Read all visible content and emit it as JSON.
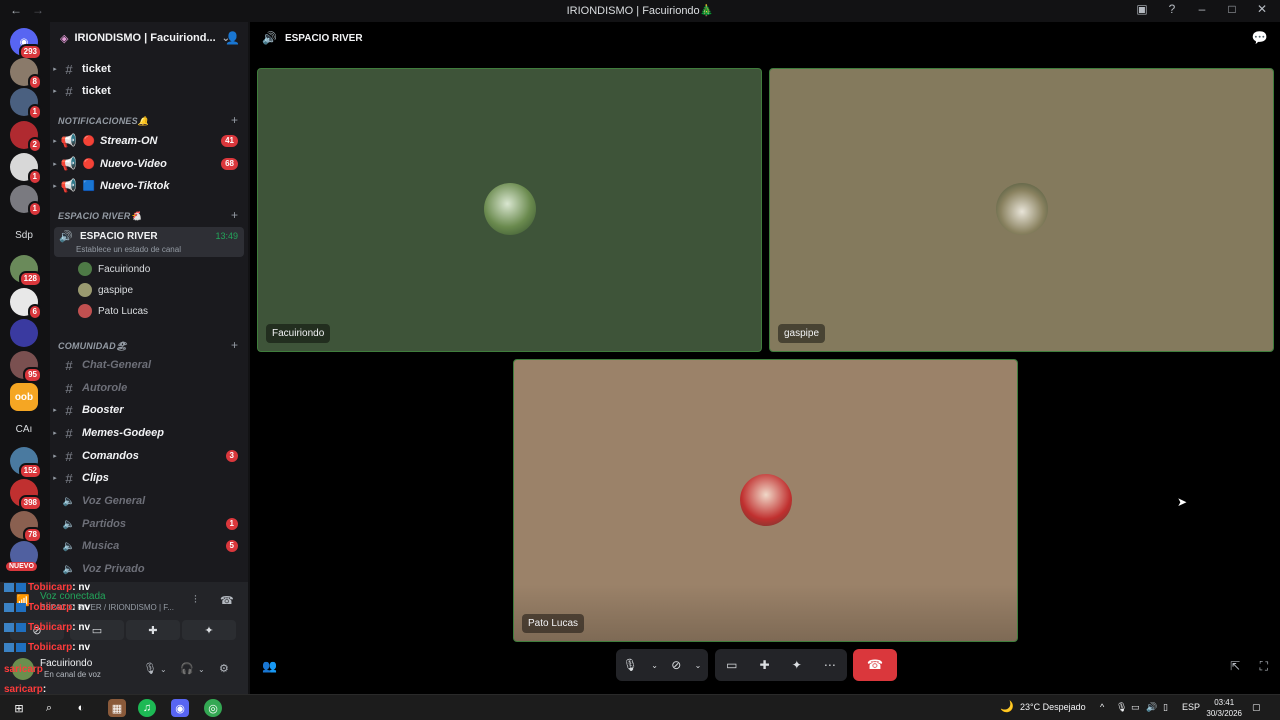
{
  "window": {
    "title": "IRIONDISMO | Facuiriondo🎄"
  },
  "rail": {
    "home_badge": "293",
    "items": [
      {
        "badge": "8"
      },
      {
        "badge": "1"
      },
      {
        "badge": "2"
      },
      {
        "badge": "1"
      },
      {
        "badge": "1"
      },
      {
        "label": "Sdp"
      },
      {
        "badge": "128"
      },
      {
        "badge": "6"
      },
      {
        "badge": ""
      },
      {
        "badge": "95"
      },
      {
        "label": "oob"
      },
      {
        "label": "CAı"
      },
      {
        "badge": "152"
      },
      {
        "badge": "398"
      },
      {
        "badge": "78"
      },
      {
        "badge": "NUEVO"
      }
    ]
  },
  "sidebar": {
    "guild_name": "IRIONDISMO | Facuiriond...",
    "channels_top": [
      "ticket",
      "ticket"
    ],
    "cat_notificaciones": "NOTIFICACIONES🔔",
    "notif": [
      {
        "emoji": "🔴",
        "name": "Stream-ON",
        "count": "41"
      },
      {
        "emoji": "🔴",
        "name": "Nuevo-Video",
        "count": "68"
      },
      {
        "emoji": "🟦",
        "name": "Nuevo-Tiktok",
        "count": ""
      }
    ],
    "cat_river": "ESPACIO RIVER🐔",
    "active_channel": {
      "name": "ESPACIO RIVER",
      "time": "13:49",
      "status": "Establece un estado de canal"
    },
    "voice_users": [
      "Facuiriondo",
      "gaspipe",
      "Pato Lucas"
    ],
    "cat_comunidad": "COMUNIDAD🏖",
    "comunidad": [
      {
        "name": "Chat-General",
        "count": "",
        "bright": false,
        "voice": false
      },
      {
        "name": "Autorole",
        "count": "",
        "bright": false,
        "voice": false
      },
      {
        "name": "Booster",
        "count": "",
        "bright": true,
        "voice": false
      },
      {
        "name": "Memes-Godeep",
        "count": "",
        "bright": true,
        "voice": false
      },
      {
        "name": "Comandos",
        "count": "3",
        "bright": true,
        "voice": false
      },
      {
        "name": "Clips",
        "count": "",
        "bright": true,
        "voice": false
      },
      {
        "name": "Voz General",
        "count": "",
        "bright": false,
        "voice": true
      },
      {
        "name": "Partidos",
        "count": "1",
        "bright": false,
        "voice": true
      },
      {
        "name": "Musica",
        "count": "5",
        "bright": false,
        "voice": true
      },
      {
        "name": "Voz Privado",
        "count": "",
        "bright": false,
        "voice": true
      }
    ]
  },
  "voice_panel": {
    "status": "Voz conectada",
    "sub": "ESPACIO RIVER / IRIONDISMO | F...",
    "user_name": "Facuiriondo",
    "user_sub": "En canal de voz"
  },
  "overlay_chat": [
    {
      "user": "Tobiicarp",
      "msg": ": nv"
    },
    {
      "user": "Tobiicarp",
      "msg": ": nv"
    },
    {
      "user": "Tobiicarp",
      "msg": ": nv"
    },
    {
      "user": "Tobiicarp",
      "msg": ": nv"
    },
    {
      "user": "saricarp",
      "msg": ""
    },
    {
      "user": "saricarp",
      "msg": ":"
    }
  ],
  "main": {
    "header_title": "ESPACIO RIVER",
    "tiles": [
      {
        "name": "Facuiriondo"
      },
      {
        "name": "gaspipe"
      },
      {
        "name": "Pato Lucas"
      }
    ]
  },
  "taskbar": {
    "weather": "23°C  Despejado",
    "lang": "ESP",
    "time": "03:41",
    "date": "30/3/2026"
  },
  "colors": {
    "accent_green": "#23a55a",
    "hangup_red": "#da373c",
    "tile_border": "#3f7d3c"
  }
}
